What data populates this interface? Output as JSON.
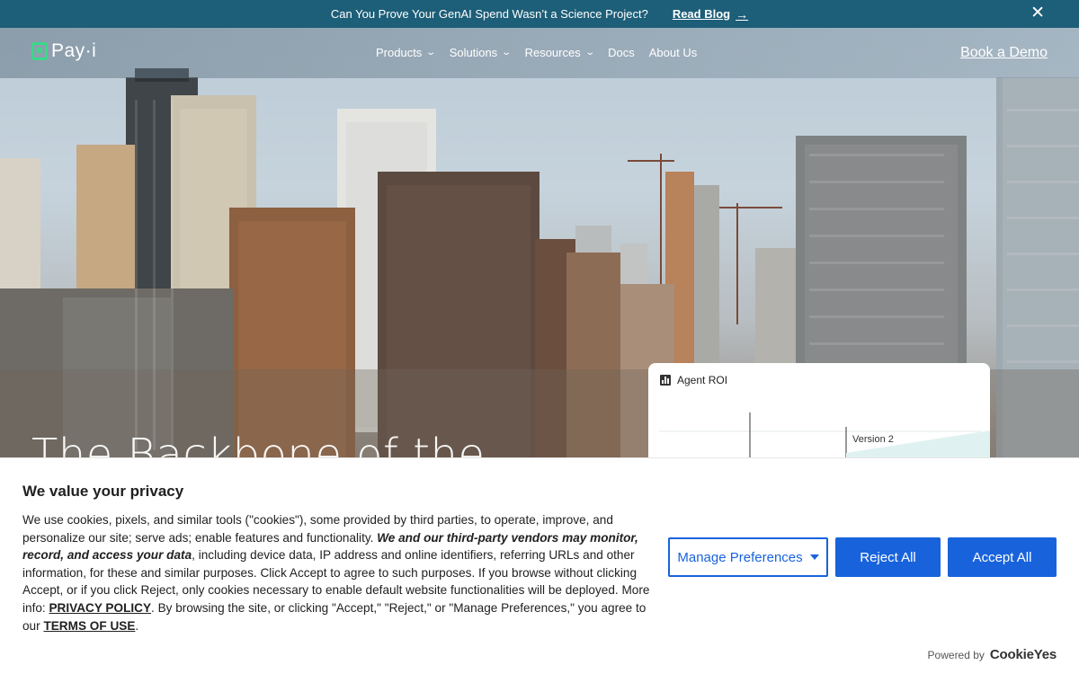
{
  "announcement": {
    "message": "Can You Prove Your GenAI Spend Wasn’t a Science Project?",
    "link_label": "Read Blog",
    "link_arrow": "→",
    "close_glyph": "✕"
  },
  "nav": {
    "logo_text": "Pay·i",
    "items": [
      {
        "label": "Products",
        "has_dropdown": true
      },
      {
        "label": "Solutions",
        "has_dropdown": true
      },
      {
        "label": "Resources",
        "has_dropdown": true
      },
      {
        "label": "Docs",
        "has_dropdown": false
      },
      {
        "label": "About Us",
        "has_dropdown": false
      }
    ],
    "chevron_glyph": "⌄",
    "cta": "Book a Demo"
  },
  "hero": {
    "headline": "The Backbone of the"
  },
  "roi_card": {
    "title": "Agent ROI",
    "version_label": "Version 2"
  },
  "cookie": {
    "title": "We value your privacy",
    "text_part1": "We use cookies, pixels, and similar tools (\"cookies\"), some provided by third parties, to operate, improve, and personalize our site; serve ads; enable features and functionality. ",
    "text_bold": "We and our third-party vendors may monitor, record, and access your data",
    "text_part2": ", including device data, IP address and online identifiers, referring URLs and other information, for these and similar purposes. Click Accept to agree to such purposes. If you browse without clicking Accept, or if you click Reject, only cookies necessary to enable default website functionalities will be deployed. More info: ",
    "privacy_link": "PRIVACY POLICY",
    "text_part3": ". By browsing the site, or clicking \"Accept,\" \"Reject,\" or \"Manage Preferences,\" you agree to our ",
    "terms_link": "TERMS OF USE",
    "text_end": ".",
    "manage_label": "Manage Preferences",
    "reject_label": "Reject All",
    "accept_label": "Accept All",
    "powered_by": "Powered by",
    "powered_brand": "CookieYes",
    "accent_color": "#1863dc"
  }
}
